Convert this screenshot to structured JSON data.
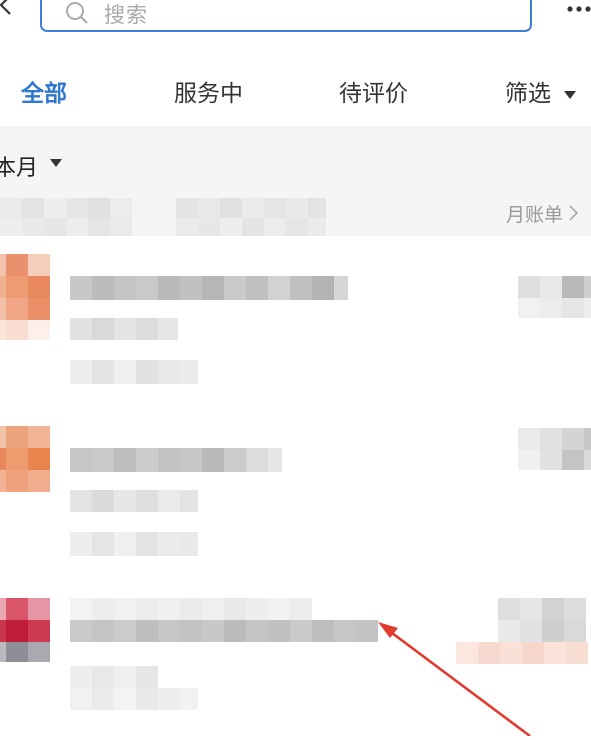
{
  "header": {
    "search_placeholder": "搜索",
    "back_icon": "chevron-left-icon",
    "more_icon": "more-dots-icon",
    "accent": "#2f77d1"
  },
  "tabs": [
    {
      "label": "全部",
      "active": true
    },
    {
      "label": "服务中",
      "active": false
    },
    {
      "label": "待评价",
      "active": false
    },
    {
      "label": "筛选",
      "active": false
    }
  ],
  "month": {
    "label": "本月",
    "bill_link": "月账单"
  },
  "colors": {
    "tab_active": "#2f77d1",
    "section_bg": "#f5f5f5",
    "annotation_arrow": "#e23b2e"
  }
}
